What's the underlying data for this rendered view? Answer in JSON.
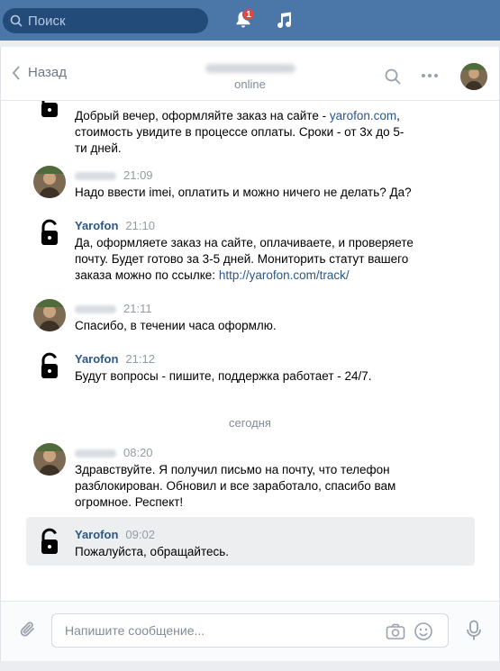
{
  "topbar": {
    "search_placeholder": "Поиск",
    "notifications_count": "1",
    "accent": "#4a76a8"
  },
  "header": {
    "back_label": "Назад",
    "status": "online"
  },
  "messages": [
    {
      "author": "",
      "time": "",
      "lines": [
        "Добрый вечер, оформляйте заказ на сайте - ",
        "стоимость увидите в процессе оплаты. Сроки - от 3х до 5-",
        "ти дней."
      ],
      "link": "yarofon.com"
    },
    {
      "author": "",
      "time": "21:09",
      "text": "Надо ввести imei, оплатить и можно ничего не делать? Да?"
    },
    {
      "author": "Yarofon",
      "time": "21:10",
      "lines": [
        "Да, оформляете заказ на сайте, оплачиваете, и проверяете",
        "почту. Будет готово за 3-5 дней. Мониторить статут вашего",
        "заказа можно по ссылке: "
      ],
      "link": "http://yarofon.com/track/"
    },
    {
      "author": "",
      "time": "21:11",
      "text": "Спасибо, в течении часа оформлю."
    },
    {
      "author": "Yarofon",
      "time": "21:12",
      "text": "Будут вопросы - пишите, поддержка работает - 24/7."
    },
    {
      "author": "",
      "time": "08:20",
      "lines": [
        "Здравствуйте. Я получил письмо на почту, что телефон",
        "разблокирован. Обновил и все заработало, спасибо вам",
        "огромное. Респект!"
      ]
    },
    {
      "author": "Yarofon",
      "time": "09:02",
      "text": "Пожалуйста, обращайтесь."
    }
  ],
  "day_separator": "сегодня",
  "composer": {
    "placeholder": "Напишите сообщение..."
  }
}
